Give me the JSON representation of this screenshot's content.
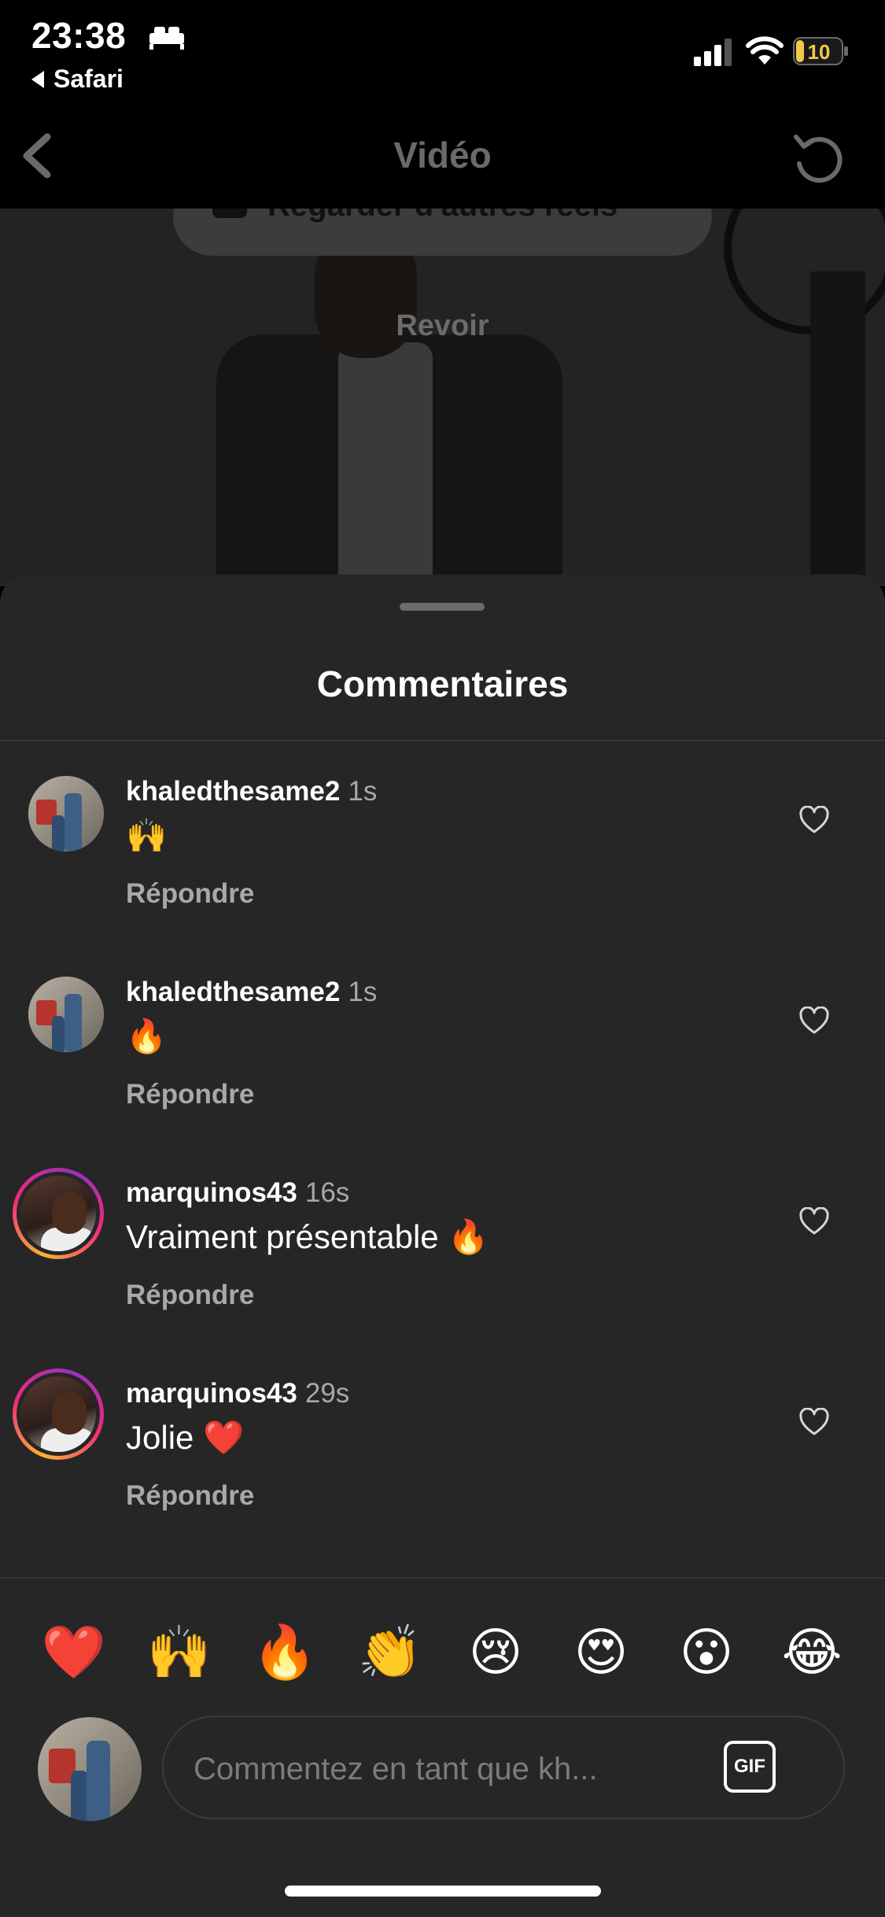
{
  "status_bar": {
    "time": "23:38",
    "back_app": "Safari",
    "battery": "10",
    "icons": [
      "bed-icon",
      "signal-icon",
      "wifi-icon",
      "battery-icon"
    ]
  },
  "nav": {
    "title": "Vidéo",
    "back_icon": "chevron-left-icon",
    "refresh_icon": "refresh-icon"
  },
  "video": {
    "pill_label": "Regarder d'autres reels",
    "replay_label": "Revoir"
  },
  "comments": {
    "title": "Commentaires",
    "items": [
      {
        "user": "khaledthesame2",
        "time": "1s",
        "text": "🙌",
        "reply": "Répondre"
      },
      {
        "user": "khaledthesame2",
        "time": "1s",
        "text": "🔥",
        "reply": "Répondre"
      },
      {
        "user": "marquinos43",
        "time": "16s",
        "text": "Vraiment présentable 🔥",
        "reply": "Répondre"
      },
      {
        "user": "marquinos43",
        "time": "29s",
        "text": "Jolie ❤️",
        "reply": "Répondre"
      }
    ]
  },
  "emoji_bar": [
    "❤️",
    "🙌",
    "🔥",
    "👏",
    "😢",
    "😍",
    "😮",
    "😂"
  ],
  "composer": {
    "placeholder": "Commentez en tant que kh...",
    "gif_label": "GIF"
  },
  "colors": {
    "sheet_bg": "#262626",
    "secondary_text": "#a8a8a8",
    "story_ring": [
      "#f9b233",
      "#ee2a7b",
      "#9b2fbf"
    ]
  }
}
